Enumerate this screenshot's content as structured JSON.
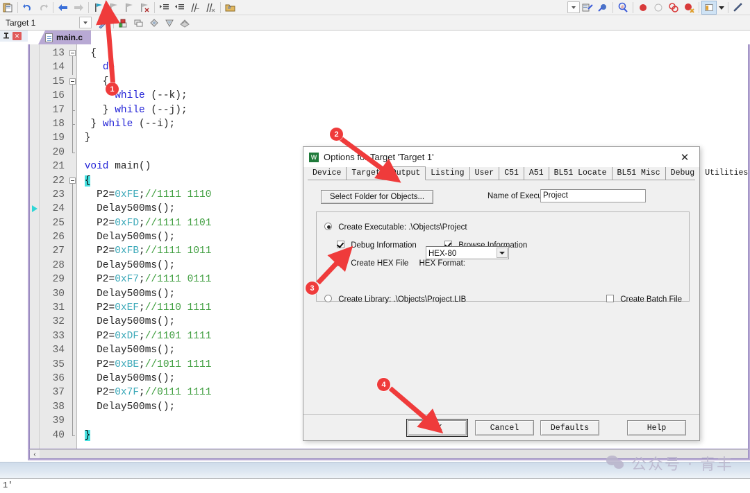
{
  "app": {
    "target_label": "Target 1",
    "tab_filename": "main.c",
    "status_text": "1'",
    "watermark": "公众号 · 青丰"
  },
  "toolbar": {
    "icons": [
      "paste-icon",
      "undo-icon",
      "redo-icon",
      "back-icon",
      "forward-icon",
      "bookmark-toggle-icon",
      "bookmark-prev-icon",
      "bookmark-next-icon",
      "bookmark-clear-icon",
      "indent-icon",
      "outdent-icon",
      "comment-icon",
      "uncomment-icon",
      "open-folder-icon"
    ],
    "right_icons": [
      "target-dropdown-icon",
      "build-icon",
      "rebuild-icon",
      "find-in-files-icon",
      "breakpoint-icon",
      "breakpoint-disable-icon",
      "breakpoint-kill-icon",
      "breakpoint-clear-icon",
      "window-layout-icon",
      "layout-dropdown-icon",
      "configure-icon"
    ],
    "target_icons": [
      "magic-wand-icon",
      "manage-targets-icon",
      "copy-target-icon",
      "new-item-icon",
      "remove-item-icon",
      "batch-build-icon"
    ]
  },
  "editor": {
    "first_line": 13,
    "exec_line": 24,
    "lines": [
      {
        "n": 13,
        "text": "  {",
        "fold": "start"
      },
      {
        "n": 14,
        "text": "    do",
        "fold": "bar"
      },
      {
        "n": 15,
        "text": "    {",
        "fold": "start"
      },
      {
        "n": 16,
        "text": "      while (--k);",
        "fold": "bar"
      },
      {
        "n": 17,
        "text": "    } while (--j);",
        "fold": "tick"
      },
      {
        "n": 18,
        "text": "  } while (--i);",
        "fold": "tick"
      },
      {
        "n": 19,
        "text": " }",
        "fold": "bar"
      },
      {
        "n": 20,
        "text": "",
        "fold": "end"
      },
      {
        "n": 21,
        "text": " void main()",
        "fold": "none"
      },
      {
        "n": 22,
        "text": " {",
        "fold": "start"
      },
      {
        "n": 23,
        "text": "   P2=0xFE;//1111 1110",
        "fold": "bar"
      },
      {
        "n": 24,
        "text": "   Delay500ms();",
        "fold": "bar"
      },
      {
        "n": 25,
        "text": "   P2=0xFD;//1111 1101",
        "fold": "bar"
      },
      {
        "n": 26,
        "text": "   Delay500ms();",
        "fold": "bar"
      },
      {
        "n": 27,
        "text": "   P2=0xFB;//1111 1011",
        "fold": "bar"
      },
      {
        "n": 28,
        "text": "   Delay500ms();",
        "fold": "bar"
      },
      {
        "n": 29,
        "text": "   P2=0xF7;//1111 0111",
        "fold": "bar"
      },
      {
        "n": 30,
        "text": "   Delay500ms();",
        "fold": "bar"
      },
      {
        "n": 31,
        "text": "   P2=0xEF;//1110 1111",
        "fold": "bar"
      },
      {
        "n": 32,
        "text": "   Delay500ms();",
        "fold": "bar"
      },
      {
        "n": 33,
        "text": "   P2=0xDF;//1101 1111",
        "fold": "bar"
      },
      {
        "n": 34,
        "text": "   Delay500ms();",
        "fold": "bar"
      },
      {
        "n": 35,
        "text": "   P2=0xBE;//1011 1111",
        "fold": "bar"
      },
      {
        "n": 36,
        "text": "   Delay500ms();",
        "fold": "bar"
      },
      {
        "n": 37,
        "text": "   P2=0x7F;//0111 1111",
        "fold": "bar"
      },
      {
        "n": 38,
        "text": "   Delay500ms();",
        "fold": "bar"
      },
      {
        "n": 39,
        "text": "",
        "fold": "bar"
      },
      {
        "n": 40,
        "text": " }",
        "fold": "end"
      }
    ]
  },
  "dialog": {
    "title": "Options for Target 'Target 1'",
    "close_label": "✕",
    "tabs": [
      {
        "label": "Device",
        "selected": false
      },
      {
        "label": "Target",
        "selected": false
      },
      {
        "label": "Output",
        "selected": true
      },
      {
        "label": "Listing",
        "selected": false
      },
      {
        "label": "User",
        "selected": false
      },
      {
        "label": "C51",
        "selected": false
      },
      {
        "label": "A51",
        "selected": false
      },
      {
        "label": "BL51 Locate",
        "selected": false
      },
      {
        "label": "BL51 Misc",
        "selected": false
      },
      {
        "label": "Debug",
        "selected": false
      },
      {
        "label": "Utilities",
        "selected": false
      }
    ],
    "select_folder_label": "Select Folder for Objects...",
    "name_of_executable_label": "Name of Executable:",
    "name_of_executable_value": "Project",
    "create_executable_label": "Create Executable:  .\\Objects\\Project",
    "create_executable_checked": true,
    "debug_information_label": "Debug Information",
    "debug_information_checked": true,
    "browse_information_label": "Browse Information",
    "browse_information_checked": true,
    "create_hex_label": "Create HEX File",
    "create_hex_checked": true,
    "hex_format_label": "HEX Format:",
    "hex_format_value": "HEX-80",
    "create_library_label": "Create Library:  .\\Objects\\Project.LIB",
    "create_library_checked": false,
    "create_batch_label": "Create Batch File",
    "create_batch_checked": false,
    "buttons": {
      "ok": "OK",
      "cancel": "Cancel",
      "defaults": "Defaults",
      "help": "Help"
    }
  },
  "annotations": {
    "markers": [
      {
        "id": "1",
        "label": "1"
      },
      {
        "id": "2",
        "label": "2"
      },
      {
        "id": "3",
        "label": "3"
      },
      {
        "id": "4",
        "label": "4"
      }
    ],
    "color": "#ef3b3b"
  }
}
